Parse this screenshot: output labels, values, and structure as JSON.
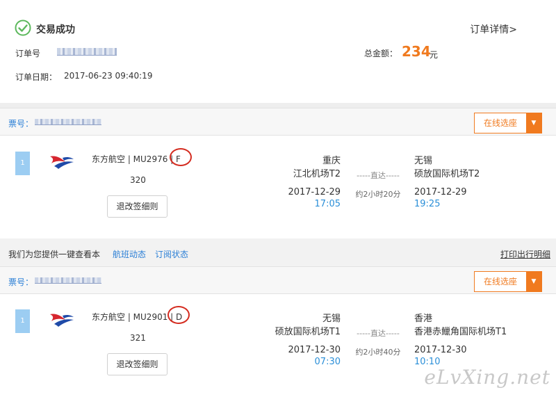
{
  "order": {
    "status": "交易成功",
    "detail_link": "订单详情>",
    "number_label": "订单号",
    "date_label": "订单日期：",
    "date_value": "2017-06-23 09:40:19",
    "total_label": "总金额：",
    "total_value": "234",
    "total_unit": "元"
  },
  "tickets": [
    {
      "ticket_label": "票号：",
      "seat_button": "在线选座",
      "index": "1",
      "flight": "东方航空 | MU2976 | F",
      "plane": "320",
      "rule_button": "退改签细则",
      "dep_city": "重庆",
      "dep_airport": "江北机场T2",
      "route": "-----直达-----",
      "duration": "约2小时20分",
      "arr_city": "无锡",
      "arr_airport": "硕放国际机场T2",
      "dep_date": "2017-12-29",
      "dep_time": "17:05",
      "arr_date": "2017-12-29",
      "arr_time": "19:25"
    },
    {
      "ticket_label": "票号：",
      "seat_button": "在线选座",
      "index": "1",
      "flight": "东方航空 | MU2901 | D",
      "plane": "321",
      "rule_button": "退改签细则",
      "dep_city": "无锡",
      "dep_airport": "硕放国际机场T1",
      "route": "-----直达-----",
      "duration": "约2小时40分",
      "arr_city": "香港",
      "arr_airport": "香港赤鱲角国际机场T1",
      "dep_date": "2017-12-30",
      "dep_time": "07:30",
      "arr_date": "2017-12-30",
      "arr_time": "10:10"
    }
  ],
  "helper": {
    "text": "我们为您提供一键查看本",
    "flight_status_link": "航班动态",
    "subscribe_link": "订阅状态",
    "print_link": "打印出行明细"
  },
  "watermark": "eLvXing.net",
  "colors": {
    "accent_orange": "#f07a1f",
    "link_blue": "#2b7fd6",
    "time_blue": "#2b8fd8",
    "success_green": "#5cb85c",
    "annotation_red": "#d42b1f"
  },
  "icons": {
    "status": "check-circle-icon",
    "airline": "china-eastern-logo",
    "dropdown": "caret-down-icon"
  }
}
